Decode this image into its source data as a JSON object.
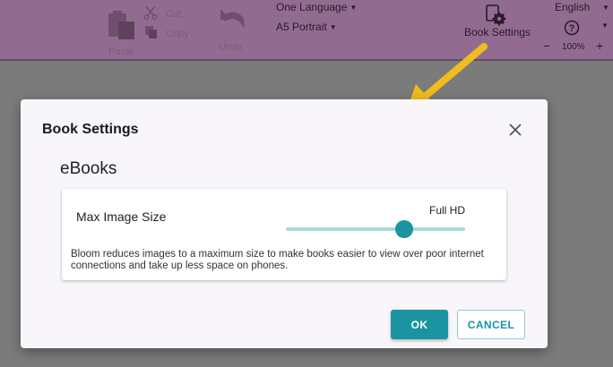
{
  "toolbar": {
    "paste_label": "Paste",
    "cut_label": "Cut",
    "copy_label": "Copy",
    "undo_label": "Undo",
    "language_select": "One Language",
    "page_size_select": "A5 Portrait",
    "book_settings_label": "Book Settings",
    "ui_language": "English",
    "zoom_minus": "−",
    "zoom_value": "100%",
    "zoom_plus": "+",
    "icons": [
      "paste-icon",
      "cut-icon",
      "copy-icon",
      "undo-icon",
      "book-settings-icon",
      "help-icon"
    ]
  },
  "dialog": {
    "title": "Book Settings",
    "close_icon": "close-icon",
    "section_title": "eBooks",
    "setting": {
      "label": "Max Image Size",
      "value_label": "Full HD",
      "slider_fraction": 0.66,
      "description": "Bloom reduces images to a maximum size to make books easier to view over poor internet connections and take up less space on phones."
    },
    "ok_label": "OK",
    "cancel_label": "CANCEL"
  },
  "colors": {
    "toolbar_bg": "#926c90",
    "backdrop": "#7b7b7b",
    "accent": "#1c93a0",
    "slider_track": "#aad9dd",
    "arrow": "#f0bc1e"
  }
}
